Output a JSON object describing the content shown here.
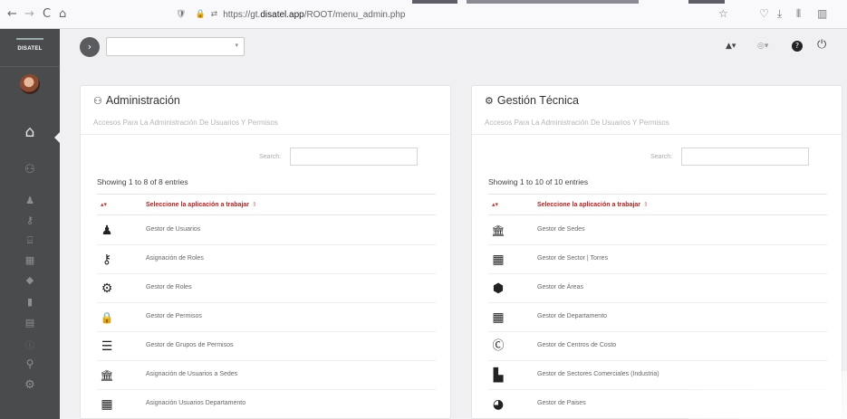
{
  "browser": {
    "back_icon": "←",
    "forward_icon": "→",
    "reload_icon": "C",
    "home_icon": "⌂",
    "shield_icon": "🛡",
    "lock_icon": "🔒",
    "permissions_icon": "⇄",
    "url_prefix": "https://gt.",
    "url_domain": "disatel.app",
    "url_path": "/ROOT/menu_admin.php",
    "bookmark_icon": "☆",
    "pocket_icon": "♡",
    "download_icon": "⤓",
    "library_icon": "⫴",
    "sidebar_icon": "▥"
  },
  "sidebar": {
    "logo_text": "DISATEL",
    "icons": [
      {
        "name": "home-icon",
        "glyph": "⌂"
      },
      {
        "name": "users-icon",
        "glyph": "⚇"
      },
      {
        "name": "user-icon",
        "glyph": "♟"
      },
      {
        "name": "key-icon",
        "glyph": "⚷"
      },
      {
        "name": "bank-icon",
        "glyph": "⌸"
      },
      {
        "name": "building-icon",
        "glyph": "▦"
      },
      {
        "name": "tag-icon",
        "glyph": "◆"
      },
      {
        "name": "building2-icon",
        "glyph": "▮"
      },
      {
        "name": "calculator-icon",
        "glyph": "▤"
      },
      {
        "name": "info-icon",
        "glyph": "ⓘ"
      },
      {
        "name": "sitemap-icon",
        "glyph": "⚲"
      },
      {
        "name": "gears-icon",
        "glyph": "⚙"
      }
    ]
  },
  "topbar": {
    "toggle_icon": "›",
    "select_value": "",
    "caret": "▾",
    "bell_icon": "▲▾",
    "language_icon": "◎▾",
    "help_icon": "?",
    "power_icon": "⏻"
  },
  "panels": {
    "admin": {
      "icon": "⚇",
      "title": "Administración",
      "subtitle": "Accesos Para La Administración De Usuarios Y Permisos",
      "search_label": "Search:",
      "search_value": "",
      "showing": "Showing 1 to 8 of 8 entries",
      "header_sort": "▴▾",
      "header_col": "Seleccione la aplicación a trabajar",
      "header_col_sort": "⇕",
      "rows": [
        {
          "icon": "user-icon",
          "glyph": "♟",
          "label": "Gestor de Usuarios"
        },
        {
          "icon": "key-icon",
          "glyph": "⚷",
          "label": "Asignación de Roles"
        },
        {
          "icon": "gears-icon",
          "glyph": "⚙",
          "label": "Gestor de Roles"
        },
        {
          "icon": "lock-icon",
          "glyph": "🔒",
          "label": "Gestor de Permisos"
        },
        {
          "icon": "list-icon",
          "glyph": "☰",
          "label": "Gestor de Grupos de Permisos"
        },
        {
          "icon": "bank-icon",
          "glyph": "🏛",
          "label": "Asignación de Usuarios a Sedes"
        },
        {
          "icon": "building-icon",
          "glyph": "▦",
          "label": "Asignación Usuarios Departamento"
        }
      ]
    },
    "tech": {
      "icon": "⚙",
      "title": "Gestión Técnica",
      "subtitle": "Accesos Para La Administración De Usuarios Y Permisos",
      "search_label": "Search:",
      "search_value": "",
      "showing": "Showing 1 to 10 of 10 entries",
      "header_sort": "▴▾",
      "header_col": "Seleccione la aplicación a trabajar",
      "header_col_sort": "⇕",
      "rows": [
        {
          "icon": "bank-icon",
          "glyph": "🏛",
          "label": "Gestor de Sedes"
        },
        {
          "icon": "building-icon",
          "glyph": "▦",
          "label": "Gestor de Sector | Torres"
        },
        {
          "icon": "cube-icon",
          "glyph": "⬢",
          "label": "Gestor de Áreas"
        },
        {
          "icon": "building2-icon",
          "glyph": "▦",
          "label": "Gestor de Departamento"
        },
        {
          "icon": "creative-commons-icon",
          "glyph": "Ⓒ",
          "label": "Gestor de Centros de Costo"
        },
        {
          "icon": "industry-icon",
          "glyph": "▙",
          "label": "Gestor de Sectores Comerciales (Industria)"
        },
        {
          "icon": "globe-icon",
          "glyph": "◕",
          "label": "Gestor de Paises"
        }
      ]
    }
  }
}
